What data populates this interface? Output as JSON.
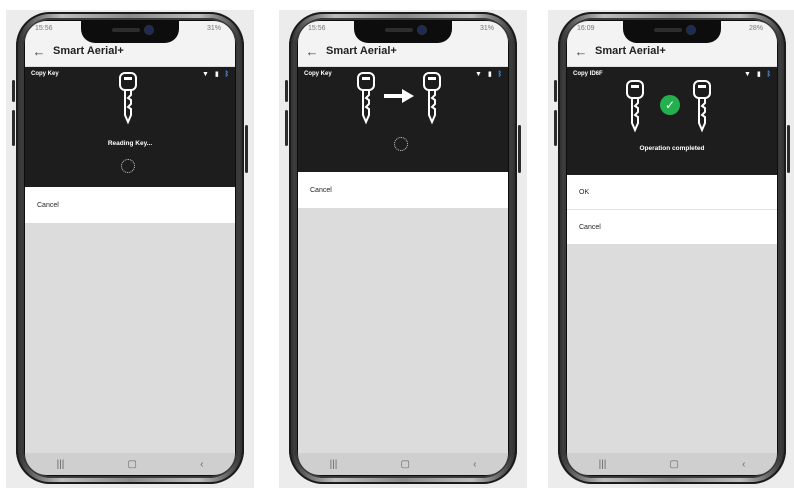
{
  "screens": [
    {
      "status": {
        "time": "15:56",
        "right": "31%"
      },
      "appbar": {
        "title": "Smart Aerial+"
      },
      "header": {
        "title": "Copy Key"
      },
      "message": "Reading Key...",
      "options": [
        "Cancel"
      ]
    },
    {
      "status": {
        "time": "15:56",
        "right": "31%"
      },
      "appbar": {
        "title": "Smart Aerial+"
      },
      "header": {
        "title": "Copy Key"
      },
      "message": "",
      "options": [
        "Cancel"
      ]
    },
    {
      "status": {
        "time": "16:09",
        "right": "28%"
      },
      "appbar": {
        "title": "Smart Aerial+"
      },
      "header": {
        "title": "Copy ID6F"
      },
      "message": "Operation completed",
      "options": [
        "OK",
        "Cancel"
      ]
    }
  ],
  "icons": {
    "back": "arrow-left-icon",
    "wifi": "wifi-icon",
    "device": "device-icon",
    "bluetooth": "bluetooth-icon",
    "key": "key-icon",
    "arrow": "arrow-right-icon",
    "check": "check-circle-icon",
    "spinner": "loading-spinner-icon",
    "nav_recent": "recent-apps-icon",
    "nav_home": "home-icon",
    "nav_back": "nav-back-icon"
  },
  "colors": {
    "dark_panel": "#1d1d1d",
    "success": "#23b14d",
    "bluetooth": "#4a8fe7"
  }
}
